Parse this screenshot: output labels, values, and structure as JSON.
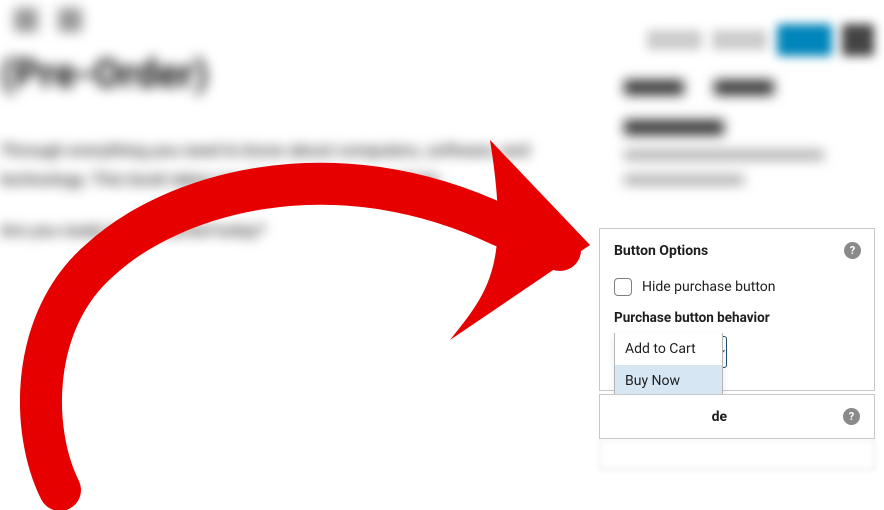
{
  "editor": {
    "title": "(Pre-Order)",
    "paragraph1": "Through everything you need to know about computers, software, and technology. This book takes you through all the essentials.",
    "paragraph2": "Are you ready to get started today?"
  },
  "sidebar_tabs": [
    "Document",
    "Block"
  ],
  "panel": {
    "title": "Button Options",
    "checkbox_label": "Hide purchase button",
    "field_label": "Purchase button behavior",
    "selected": "Add to Cart",
    "options": [
      "Add to Cart",
      "Buy Now"
    ]
  },
  "panel2": {
    "title_fragment": "de"
  }
}
